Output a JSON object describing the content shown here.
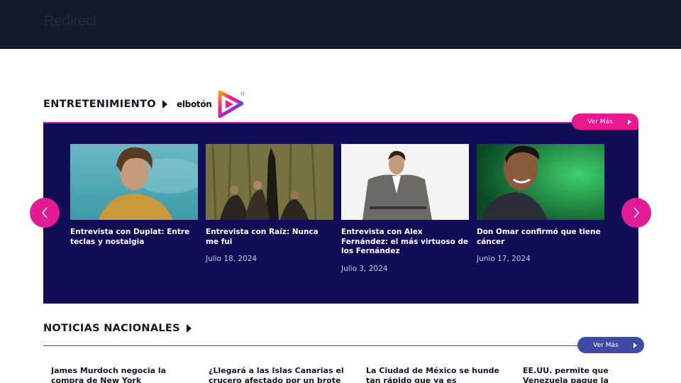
{
  "header": {
    "title": "Redirect"
  },
  "entretenimiento": {
    "title": "ENTRETENIMIENTO",
    "logo_text": "elbotón",
    "ver_mas": "Ver Más",
    "accent": "#e6198f",
    "panel_bg": "#100d56",
    "cards": [
      {
        "title": "Entrevista con Duplat: Entre teclas y nostalgia",
        "date": ""
      },
      {
        "title": "Entrevista con Raíz: Nunca me fui",
        "date": "Julio 18, 2024"
      },
      {
        "title": "Entrevista con Alex Fernández: el más virtuoso de los Fernández",
        "date": "Julio 3, 2024"
      },
      {
        "title": "Don Omar confirmó que tiene cáncer",
        "date": "Junio 17, 2024"
      }
    ]
  },
  "nacionales": {
    "title": "NOTICIAS NACIONALES",
    "ver_mas": "Ver Más",
    "accent": "#3f4aa6",
    "items": [
      {
        "title": "James Murdoch negocia la compra de New York"
      },
      {
        "title": "¿Llegará a las Islas Canarias el crucero afectado por un brote"
      },
      {
        "title": "La Ciudad de México se hunde tan rápido que ya es"
      },
      {
        "title": "EE.UU. permite que Venezuela pague la defensa"
      }
    ]
  }
}
